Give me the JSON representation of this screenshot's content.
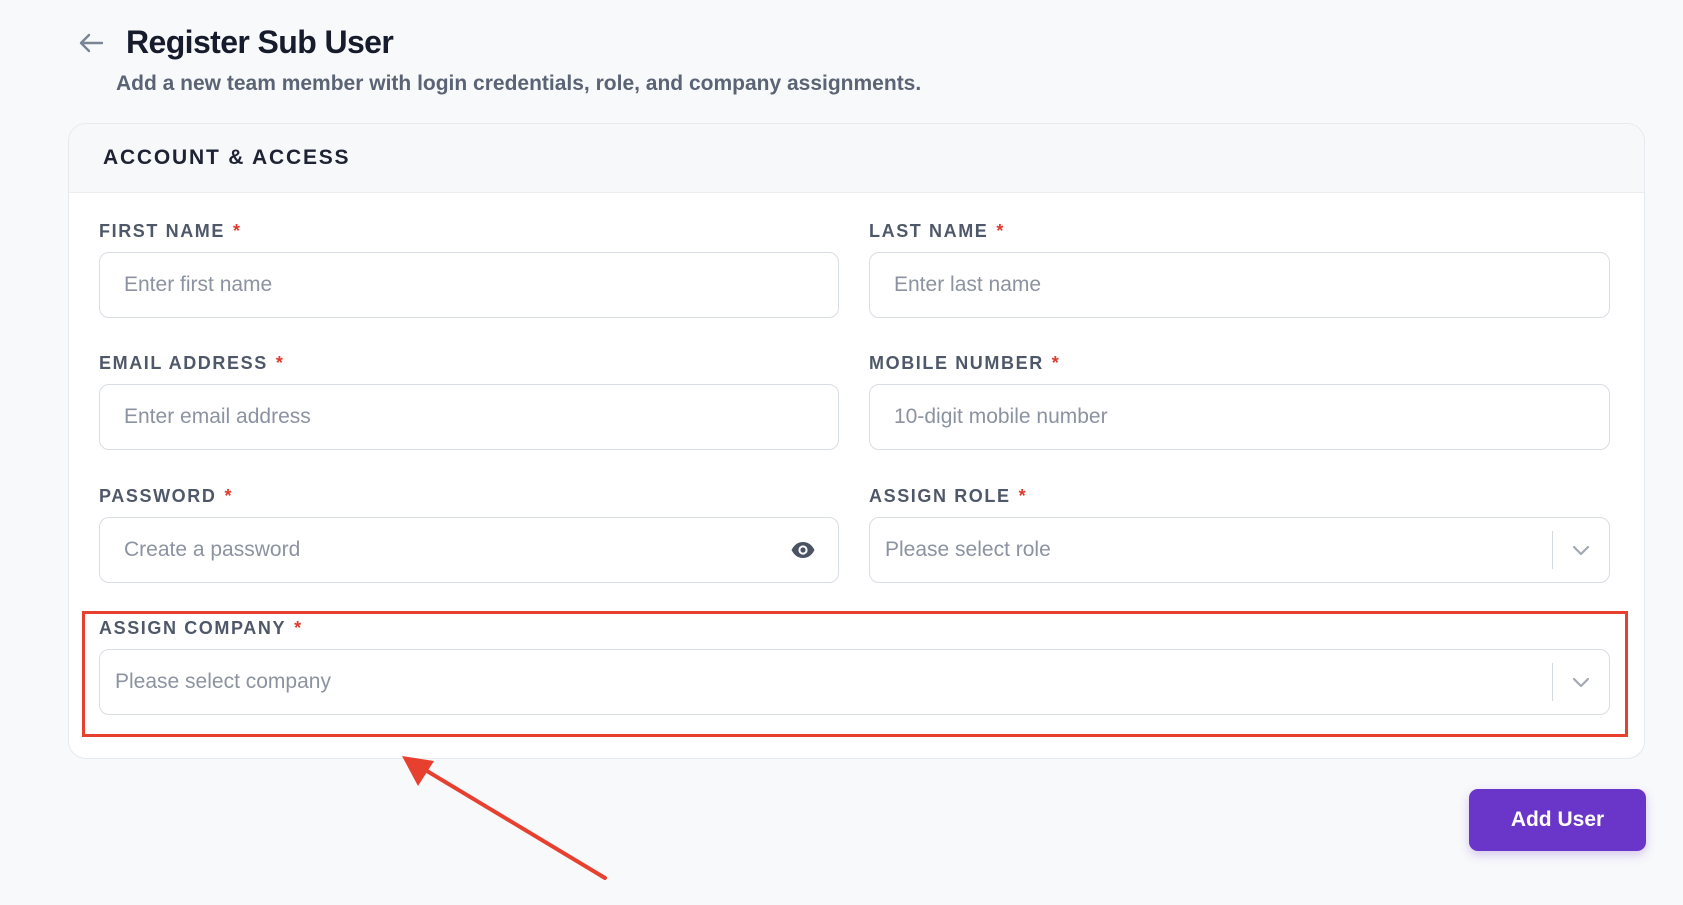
{
  "header": {
    "title": "Register Sub User",
    "subtitle": "Add a new team member with login credentials, role, and company assignments."
  },
  "card": {
    "title": "ACCOUNT & ACCESS"
  },
  "fields": {
    "first_name": {
      "label": "FIRST NAME",
      "placeholder": "Enter first name"
    },
    "last_name": {
      "label": "LAST NAME",
      "placeholder": "Enter last name"
    },
    "email": {
      "label": "EMAIL ADDRESS",
      "placeholder": "Enter email address"
    },
    "mobile": {
      "label": "MOBILE NUMBER",
      "placeholder": "10-digit mobile number"
    },
    "password": {
      "label": "PASSWORD",
      "placeholder": "Create a password"
    },
    "role": {
      "label": "ASSIGN ROLE",
      "placeholder": "Please select role"
    },
    "company": {
      "label": "ASSIGN COMPANY",
      "placeholder": "Please select company"
    }
  },
  "required_mark": "*",
  "actions": {
    "add_user": "Add User"
  },
  "icons": {
    "back": "arrow-left-icon",
    "password_toggle": "eye-icon",
    "dropdown": "chevron-down-icon"
  },
  "colors": {
    "accent": "#6a35c9",
    "required": "#e0392d",
    "annotation": "#e8402f"
  }
}
